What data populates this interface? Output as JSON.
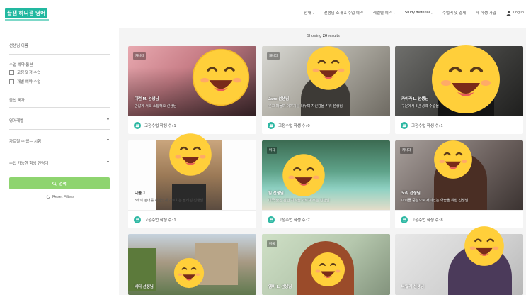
{
  "brand": {
    "logo_text": "꿀잼 하니잼 영어"
  },
  "nav": {
    "items": [
      {
        "label": "안내",
        "has_caret": true
      },
      {
        "label": "선생님 소개 & 수업 예약",
        "has_caret": false
      },
      {
        "label": "레벨별 예약",
        "has_caret": true
      },
      {
        "label": "Study material",
        "has_caret": true
      },
      {
        "label": "수업비 및 결제",
        "has_caret": false
      },
      {
        "label": "새 학생 가입",
        "has_caret": false
      }
    ],
    "login_label": "Log In"
  },
  "sidebar": {
    "teacher_name_label": "선생님 이름",
    "lesson_options_label": "수업 예약 옵션",
    "option_fixed": "고정 일정 수업",
    "option_individual": "개별 예약 수업",
    "country_label": "출신 국가",
    "level_label": "영어레벨",
    "hours_label": "가르칠 수 있는 시험",
    "age_label": "수업 가능한 학생 연령대",
    "search_label": "검색",
    "reset_label": "Reset Filters"
  },
  "results": {
    "prefix": "Showing",
    "count": "20",
    "suffix": "results"
  },
  "cards": [
    {
      "badge": "캐나다",
      "name": "대런 M. 선생님",
      "desc": "반갑게 서로 소통해요 선생님",
      "foot": "고정수업 학생 수: 1"
    },
    {
      "badge": "캐나다",
      "name": "Jane 선생님",
      "desc": "웃고 떠들며 이야기를 나누며 자신감을 키워 선생님",
      "foot": "고정수업 학생 수: 0"
    },
    {
      "badge": "",
      "name": "카이라 L. 선생님",
      "desc": "구문에서 3년 경력 수업을",
      "foot": "고정수업 학생 수: 1"
    },
    {
      "badge": "",
      "name": "니콜 J.",
      "desc": "3개의 영어를 자신있게 가르치는 필리핀 선생님",
      "foot": "고정수업 학생 수: 1"
    },
    {
      "badge": "미국",
      "name": "킴 선생님",
      "desc": "미국 출신 관련 지식을 가르쳐 주는 선생님",
      "foot": "고정수업 학생 수: 7"
    },
    {
      "badge": "캐나다",
      "name": "도리 선생님",
      "desc": "아이들 중심으로 재미있는 학습을 위한 선생님",
      "foot": "고정수업 학생 수: 8"
    },
    {
      "badge": "",
      "name": "베티 선생님",
      "desc": "",
      "foot": ""
    },
    {
      "badge": "미국",
      "name": "엠버 L. 선생님",
      "desc": "",
      "foot": ""
    },
    {
      "badge": "",
      "name": "나탈리 선생님",
      "desc": "",
      "foot": ""
    }
  ],
  "colors": {
    "brand": "#22b8a0",
    "search_button": "#8ed46f",
    "emoji": "#ffcf3a"
  }
}
